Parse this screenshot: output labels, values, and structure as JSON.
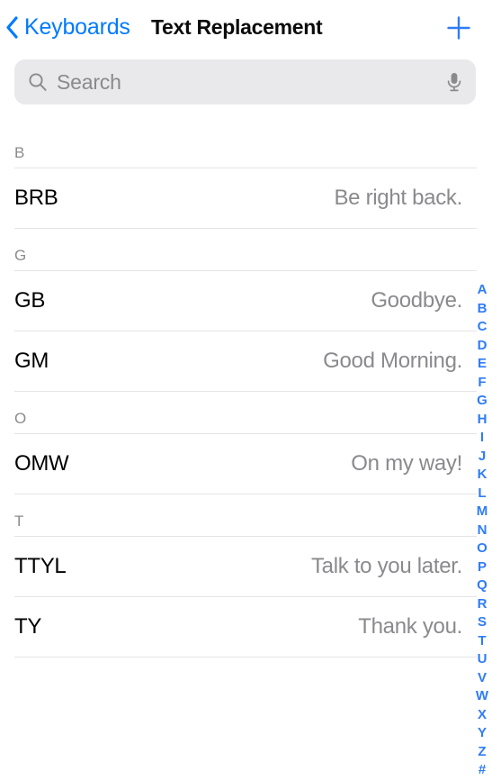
{
  "navbar": {
    "back_label": "Keyboards",
    "back_icon": "chevron-left-icon",
    "title": "Text Replacement",
    "add_icon": "plus-icon",
    "accent_color": "#007AFF",
    "title_color": "#0b0b0c"
  },
  "search": {
    "placeholder": "Search",
    "value": "",
    "search_icon": "search-icon",
    "mic_icon": "microphone-icon",
    "background_color": "#e9e9eb",
    "placeholder_color": "#8a8a8e"
  },
  "list": {
    "sections": [
      {
        "header": "B",
        "rows": [
          {
            "shortcut": "BRB",
            "phrase": "Be right back."
          }
        ]
      },
      {
        "header": "G",
        "rows": [
          {
            "shortcut": "GB",
            "phrase": "Goodbye."
          },
          {
            "shortcut": "GM",
            "phrase": "Good Morning."
          }
        ]
      },
      {
        "header": "O",
        "rows": [
          {
            "shortcut": "OMW",
            "phrase": "On my way!"
          }
        ]
      },
      {
        "header": "T",
        "rows": [
          {
            "shortcut": "TTYL",
            "phrase": "Talk to you later."
          },
          {
            "shortcut": "TY",
            "phrase": "Thank you."
          }
        ]
      }
    ],
    "separator_color": "#e4e4e6",
    "shortcut_color": "#000000",
    "phrase_color": "#8a8a8e",
    "header_color": "#8b8b8f"
  },
  "index_bar": {
    "letters": [
      "A",
      "B",
      "C",
      "D",
      "E",
      "F",
      "G",
      "H",
      "I",
      "J",
      "K",
      "L",
      "M",
      "N",
      "O",
      "P",
      "Q",
      "R",
      "S",
      "T",
      "U",
      "V",
      "W",
      "X",
      "Y",
      "Z",
      "#"
    ],
    "color": "#2f7cf6"
  }
}
